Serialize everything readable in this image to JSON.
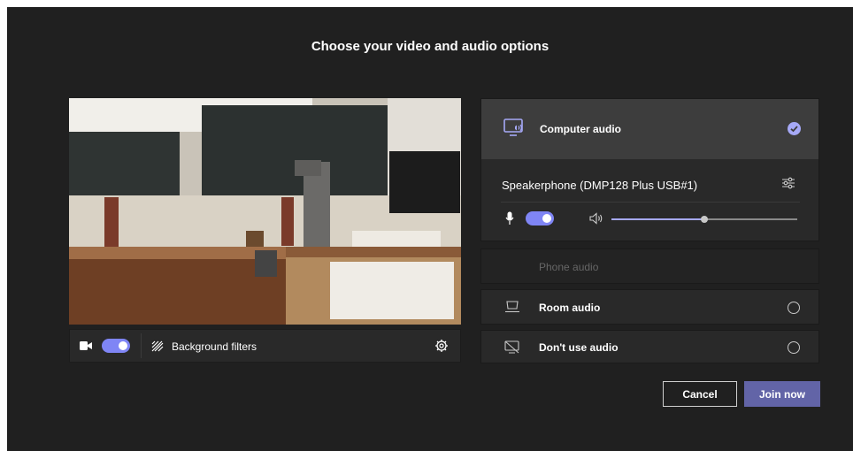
{
  "title": "Choose your video and audio options",
  "video": {
    "camera_on": true,
    "background_filters_label": "Background filters"
  },
  "audio": {
    "computer_audio": {
      "label": "Computer audio",
      "selected": true,
      "device": "Speakerphone (DMP128 Plus USB#1)",
      "mic_on": true,
      "volume": 0.5
    },
    "phone_audio_label": "Phone audio",
    "room_audio_label": "Room audio",
    "no_audio_label": "Don't use audio"
  },
  "buttons": {
    "cancel": "Cancel",
    "join": "Join now"
  },
  "colors": {
    "accent": "#7f85f5",
    "join_button": "#6264a7",
    "background": "#202020"
  }
}
